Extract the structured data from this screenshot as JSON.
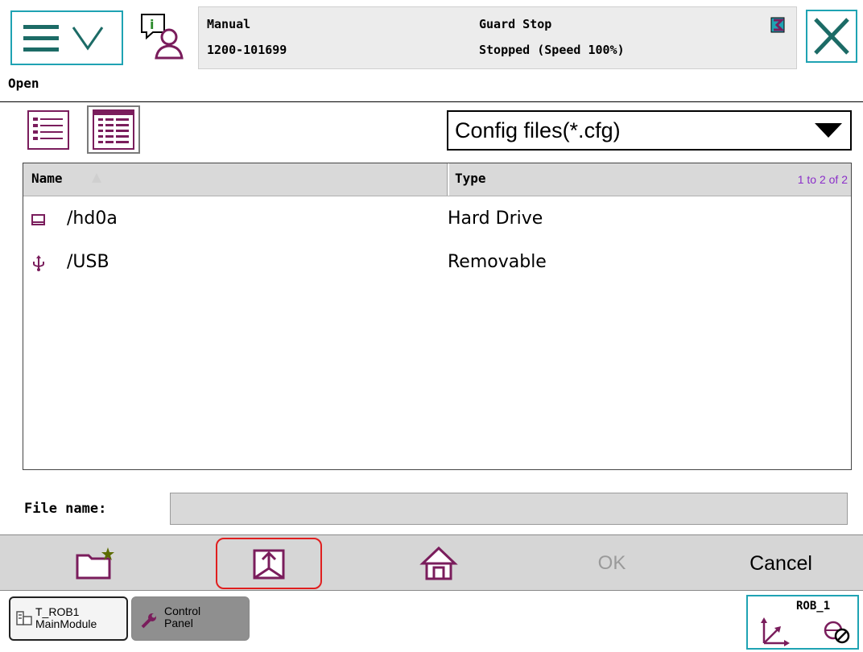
{
  "status": {
    "mode": "Manual",
    "controller": "1200-101699",
    "state": "Guard Stop",
    "motion": "Stopped (Speed 100%)"
  },
  "window": {
    "title": "Open"
  },
  "filter": {
    "selected": "Config files(*.cfg)"
  },
  "list": {
    "columns": [
      "Name",
      "Type"
    ],
    "count": "1 to 2 of 2",
    "rows": [
      {
        "icon": "hard-drive-icon",
        "name": "/hd0a",
        "type": "Hard Drive"
      },
      {
        "icon": "usb-icon",
        "name": "/USB",
        "type": "Removable"
      }
    ]
  },
  "file_name": {
    "label": "File name:",
    "value": ""
  },
  "commands": {
    "ok": "OK",
    "cancel": "Cancel"
  },
  "taskbar": {
    "task1_line1": "T_ROB1",
    "task1_line2": "MainModule",
    "task2_line1": "Control",
    "task2_line2": "Panel",
    "quickset": "ROB_1"
  },
  "colors": {
    "accent_teal": "#1fa3b3",
    "icon_purple": "#7a1d5c",
    "highlight_red": "#e01f1f",
    "count_purple": "#8b2fc9"
  }
}
